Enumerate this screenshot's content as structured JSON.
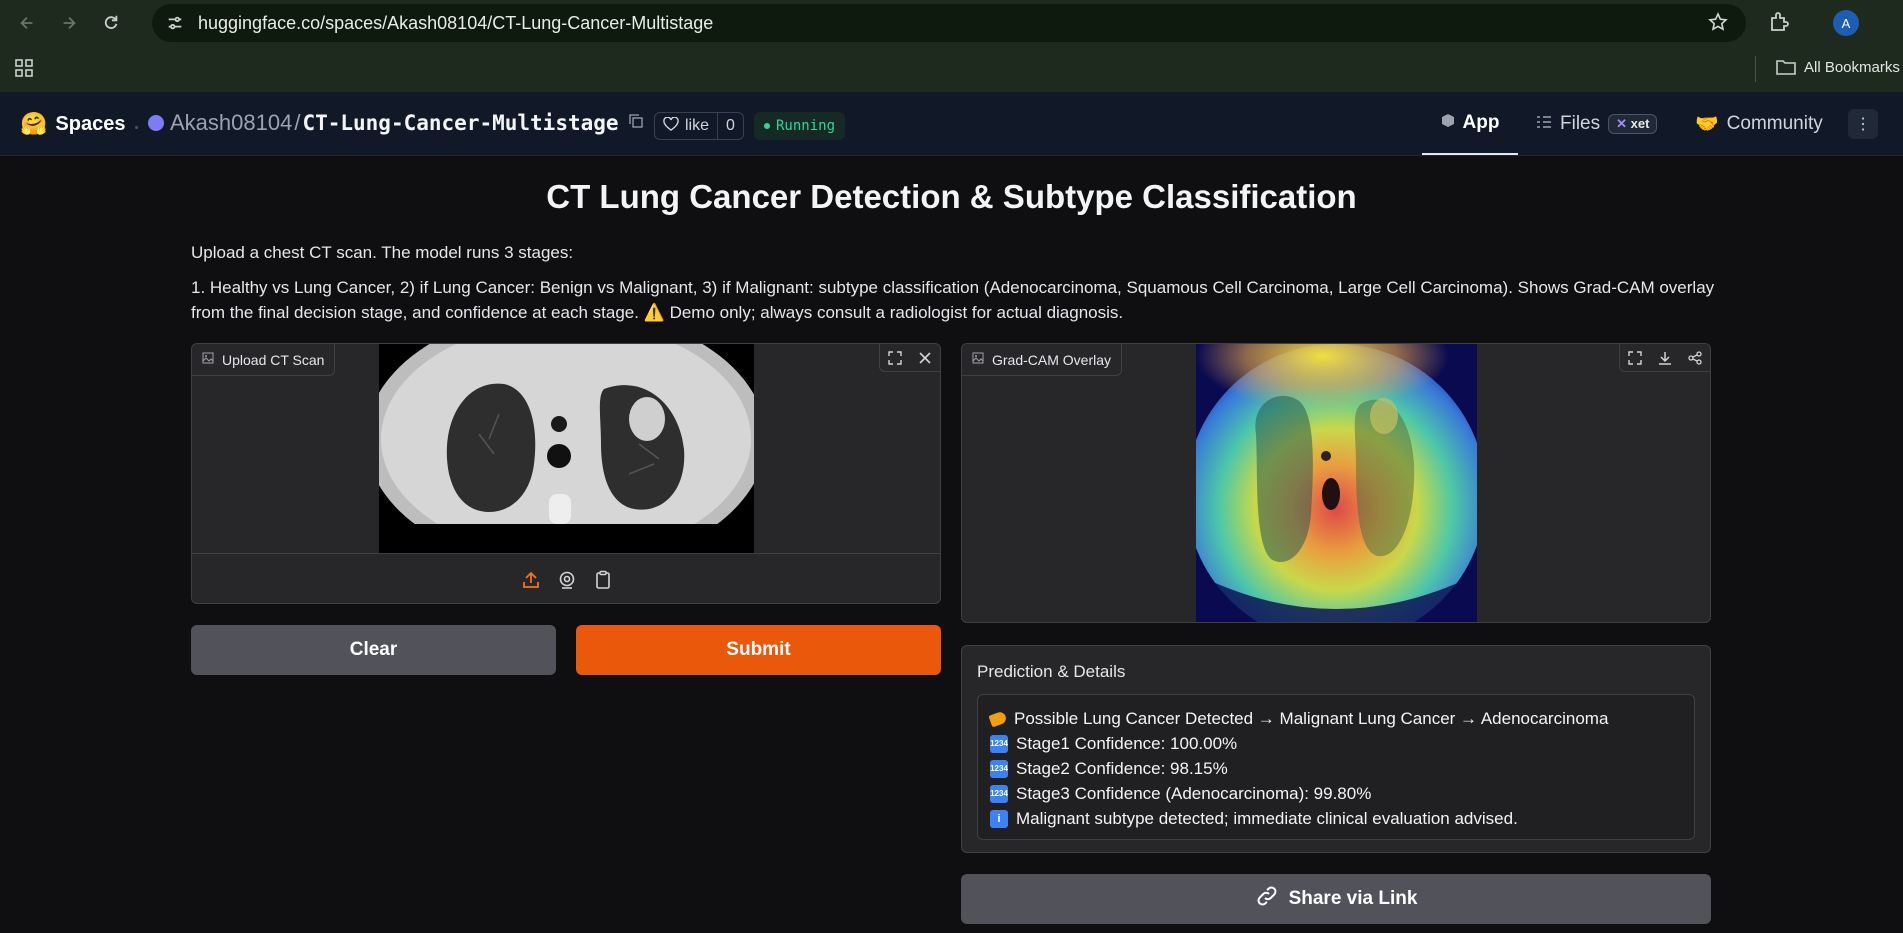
{
  "browser": {
    "url": "huggingface.co/spaces/Akash08104/CT-Lung-Cancer-Multistage",
    "profile_initial": "A",
    "bookmarks_label": "All Bookmarks"
  },
  "header": {
    "spaces_label": "Spaces",
    "owner": "Akash08104",
    "repo_name": "CT-Lung-Cancer-Multistage",
    "like_label": "like",
    "like_count": "0",
    "status": "Running",
    "tabs": {
      "app": "App",
      "files": "Files",
      "xet": "xet",
      "community": "Community"
    }
  },
  "page": {
    "title": "CT Lung Cancer Detection & Subtype Classification",
    "desc_line1": "Upload a chest CT scan. The model runs 3 stages:",
    "desc_line2": "1. Healthy vs Lung Cancer, 2) if Lung Cancer: Benign vs Malignant, 3) if Malignant: subtype classification (Adenocarcinoma, Squamous Cell Carcinoma, Large Cell Carcinoma). Shows Grad-CAM overlay from the final decision stage, and confidence at each stage. ⚠️ Demo only; always consult a radiologist for actual diagnosis."
  },
  "upload": {
    "label": "Upload CT Scan"
  },
  "gradcam": {
    "label": "Grad-CAM Overlay"
  },
  "buttons": {
    "clear": "Clear",
    "submit": "Submit",
    "share": "Share via Link"
  },
  "prediction": {
    "label": "Prediction & Details",
    "lines": [
      "Possible Lung Cancer Detected → Malignant Lung Cancer → Adenocarcinoma",
      "Stage1 Confidence: 100.00%",
      "Stage2 Confidence: 98.15%",
      "Stage3 Confidence (Adenocarcinoma): 99.80%",
      "Malignant subtype detected; immediate clinical evaluation advised."
    ]
  },
  "colors": {
    "submit": "#ea580c",
    "running": "#34d399"
  }
}
